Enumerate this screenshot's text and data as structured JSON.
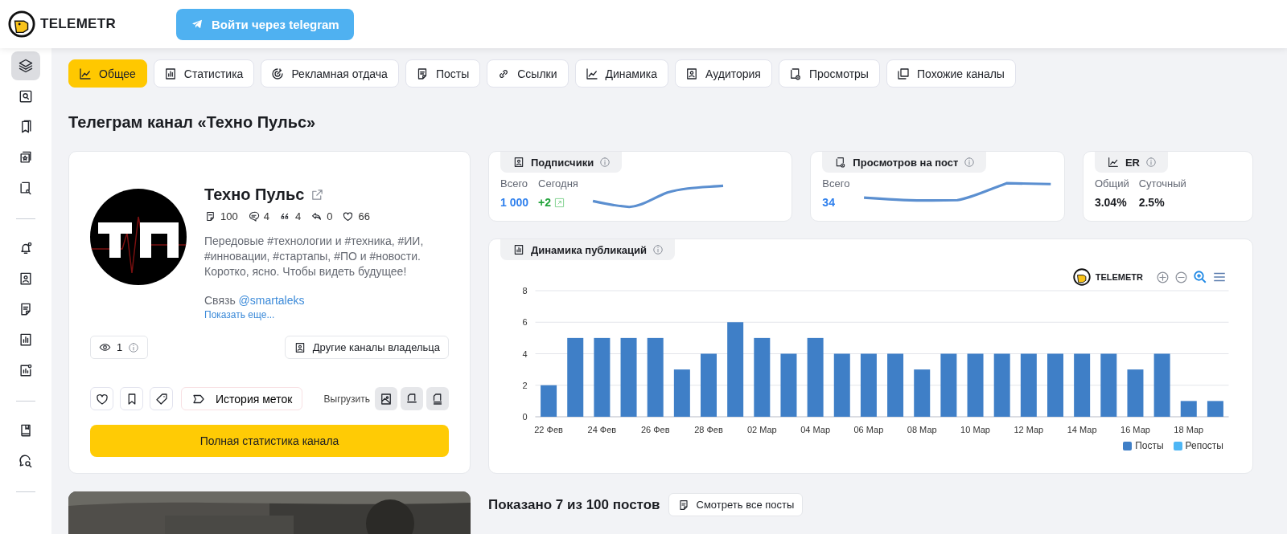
{
  "header": {
    "logo_text": "TELEMETR",
    "login_button": "Войти через telegram"
  },
  "sidebar": {
    "groups": [
      [
        {
          "kind": "layers",
          "selected": true
        },
        {
          "kind": "search",
          "selected": false
        },
        {
          "kind": "bookmarks",
          "selected": false
        },
        {
          "kind": "star",
          "selected": false
        },
        {
          "kind": "find",
          "selected": false
        }
      ],
      [
        {
          "kind": "bell",
          "selected": false
        },
        {
          "kind": "user",
          "selected": false
        },
        {
          "kind": "note",
          "selected": false
        },
        {
          "kind": "chart",
          "selected": false
        },
        {
          "kind": "chartdot",
          "selected": false
        }
      ],
      [
        {
          "kind": "book",
          "selected": false
        },
        {
          "kind": "chat",
          "selected": false
        }
      ]
    ]
  },
  "tabs": [
    {
      "label": "Общее",
      "kind": "trend",
      "selected": true
    },
    {
      "label": "Статистика",
      "kind": "chart",
      "selected": false
    },
    {
      "label": "Рекламная отдача",
      "kind": "target",
      "selected": false
    },
    {
      "label": "Посты",
      "kind": "note",
      "selected": false
    },
    {
      "label": "Ссылки",
      "kind": "link",
      "selected": false
    },
    {
      "label": "Динамика",
      "kind": "trend",
      "selected": false
    },
    {
      "label": "Аудитория",
      "kind": "user",
      "selected": false
    },
    {
      "label": "Просмотры",
      "kind": "views",
      "selected": false
    },
    {
      "label": "Похожие каналы",
      "kind": "copy",
      "selected": false
    }
  ],
  "page_title": "Телеграм канал «Техно Пульс»",
  "channel": {
    "name": "Техно Пульс",
    "counters": [
      {
        "kind": "posts",
        "value": "100"
      },
      {
        "kind": "comments",
        "value": "4"
      },
      {
        "kind": "quotes",
        "value": "4"
      },
      {
        "kind": "reposts",
        "value": "0"
      },
      {
        "kind": "likes",
        "value": "66"
      }
    ],
    "description": "Передовые #технологии и #техника, #ИИ, #инновации, #стартапы, #ПО и #новости. Коротко, ясно. Чтобы видеть будущее!",
    "contact_label": "Связь",
    "contact_link": "@smartaleks",
    "show_more": "Показать еще...",
    "views": "1",
    "owner_button": "Другие каналы владельца",
    "tags_button": "История меток",
    "export_label": "Выгрузить",
    "full_stats_button": "Полная статистика канала"
  },
  "stat_cards": [
    {
      "title": "Подписчики",
      "kind": "user",
      "metrics": [
        {
          "label": "Всего",
          "value": "1 000",
          "color": "#2f80ed",
          "growth": false
        },
        {
          "label": "Сегодня",
          "value": "+2",
          "color": "#22a33b",
          "growth": true
        }
      ],
      "sparkline": true
    },
    {
      "title": "Просмотров на пост",
      "kind": "views",
      "metrics": [
        {
          "label": "Всего",
          "value": "34",
          "color": "#2f80ed",
          "growth": false
        }
      ],
      "sparkline": true
    },
    {
      "title": "ER",
      "kind": "trend",
      "metrics": [
        {
          "label": "Общий",
          "value": "3.04%",
          "color": "#1b1d22",
          "growth": false
        },
        {
          "label": "Суточный",
          "value": "2.5%",
          "color": "#1b1d22",
          "growth": false
        }
      ],
      "sparkline": false
    }
  ],
  "publications": {
    "title": "Динамика публикаций",
    "toolbar_logo": "TELEMETR",
    "chart_data": {
      "type": "bar",
      "ylim": [
        0,
        8
      ],
      "yticks": [
        0,
        2,
        4,
        6,
        8
      ],
      "grid": true,
      "categories": [
        "22 Фев",
        null,
        "24 Фев",
        null,
        "26 Фев",
        null,
        "28 Фев",
        null,
        "02 Мар",
        null,
        "04 Мар",
        null,
        "06 Мар",
        null,
        "08 Мар",
        null,
        "10 Мар",
        null,
        "12 Мар",
        null,
        "14 Мар",
        null,
        "16 Мар",
        null,
        "18 Мар",
        null
      ],
      "series": [
        {
          "name": "Посты",
          "color": "#3f7fc7",
          "values": [
            2,
            5,
            5,
            5,
            5,
            3,
            4,
            6,
            5,
            4,
            5,
            4,
            4,
            4,
            3,
            4,
            4,
            4,
            4,
            4,
            4,
            4,
            3,
            4,
            1,
            1
          ]
        },
        {
          "name": "Репосты",
          "color": "#4db6f5",
          "values": [
            0,
            0,
            0,
            0,
            0,
            0,
            0,
            0,
            0,
            0,
            0,
            0,
            0,
            0,
            0,
            0,
            0,
            0,
            0,
            0,
            0,
            0,
            0,
            0,
            0,
            0
          ]
        }
      ]
    }
  },
  "posts": {
    "title": "Показано 7 из 100 постов",
    "all_button": "Смотреть все посты"
  }
}
